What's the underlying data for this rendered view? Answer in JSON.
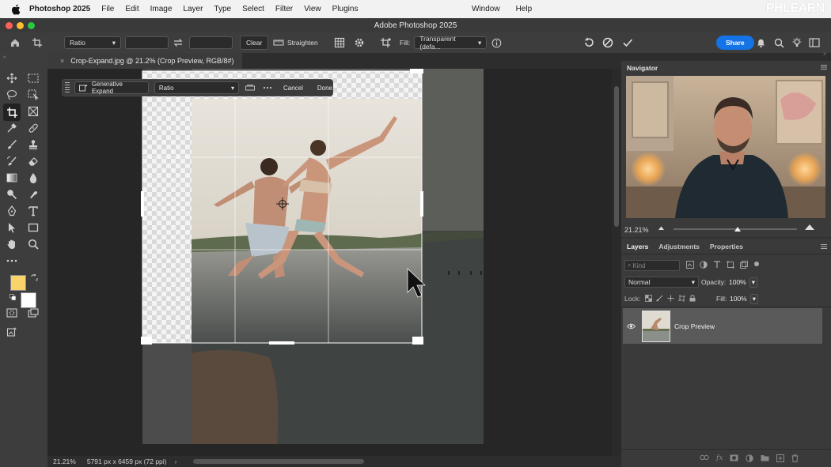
{
  "menubar": {
    "app_name": "Photoshop 2025",
    "items": [
      "File",
      "Edit",
      "Image",
      "Layer",
      "Type",
      "Select",
      "Filter",
      "View",
      "Plugins"
    ],
    "right_items": [
      "Window",
      "Help"
    ],
    "watermark": "PHLEARN"
  },
  "window": {
    "title": "Adobe Photoshop 2025"
  },
  "options": {
    "ratio_label": "Ratio",
    "clear_label": "Clear",
    "straighten_label": "Straighten",
    "fill_label": "Fill:",
    "fill_value": "Transparent (defa...",
    "share_label": "Share"
  },
  "document": {
    "tab_title": "Crop-Expand.jpg @ 21.2% (Crop Preview, RGB/8#)"
  },
  "contextual_bar": {
    "generative_expand_label": "Generative Expand",
    "ratio_label": "Ratio",
    "cancel_label": "Cancel",
    "done_label": "Done"
  },
  "status": {
    "zoom": "21.21%",
    "doc_info": "5791 px x 6459 px (72 ppi)"
  },
  "navigator": {
    "title": "Navigator",
    "zoom": "21.21%",
    "zoom_slider_fraction": 0.52
  },
  "layers_panel": {
    "tabs": [
      "Layers",
      "Adjustments",
      "Properties"
    ],
    "search_placeholder": "Kind",
    "blend_mode": "Normal",
    "opacity_label": "Opacity:",
    "opacity_value": "100%",
    "lock_label": "Lock:",
    "fill_label": "Fill:",
    "fill_value": "100%",
    "layers": [
      {
        "name": "Crop Preview",
        "visible": true,
        "selected": true
      }
    ]
  },
  "colors": {
    "foreground": "#f9d46b",
    "background": "#ffffff",
    "accent": "#1473e6"
  }
}
